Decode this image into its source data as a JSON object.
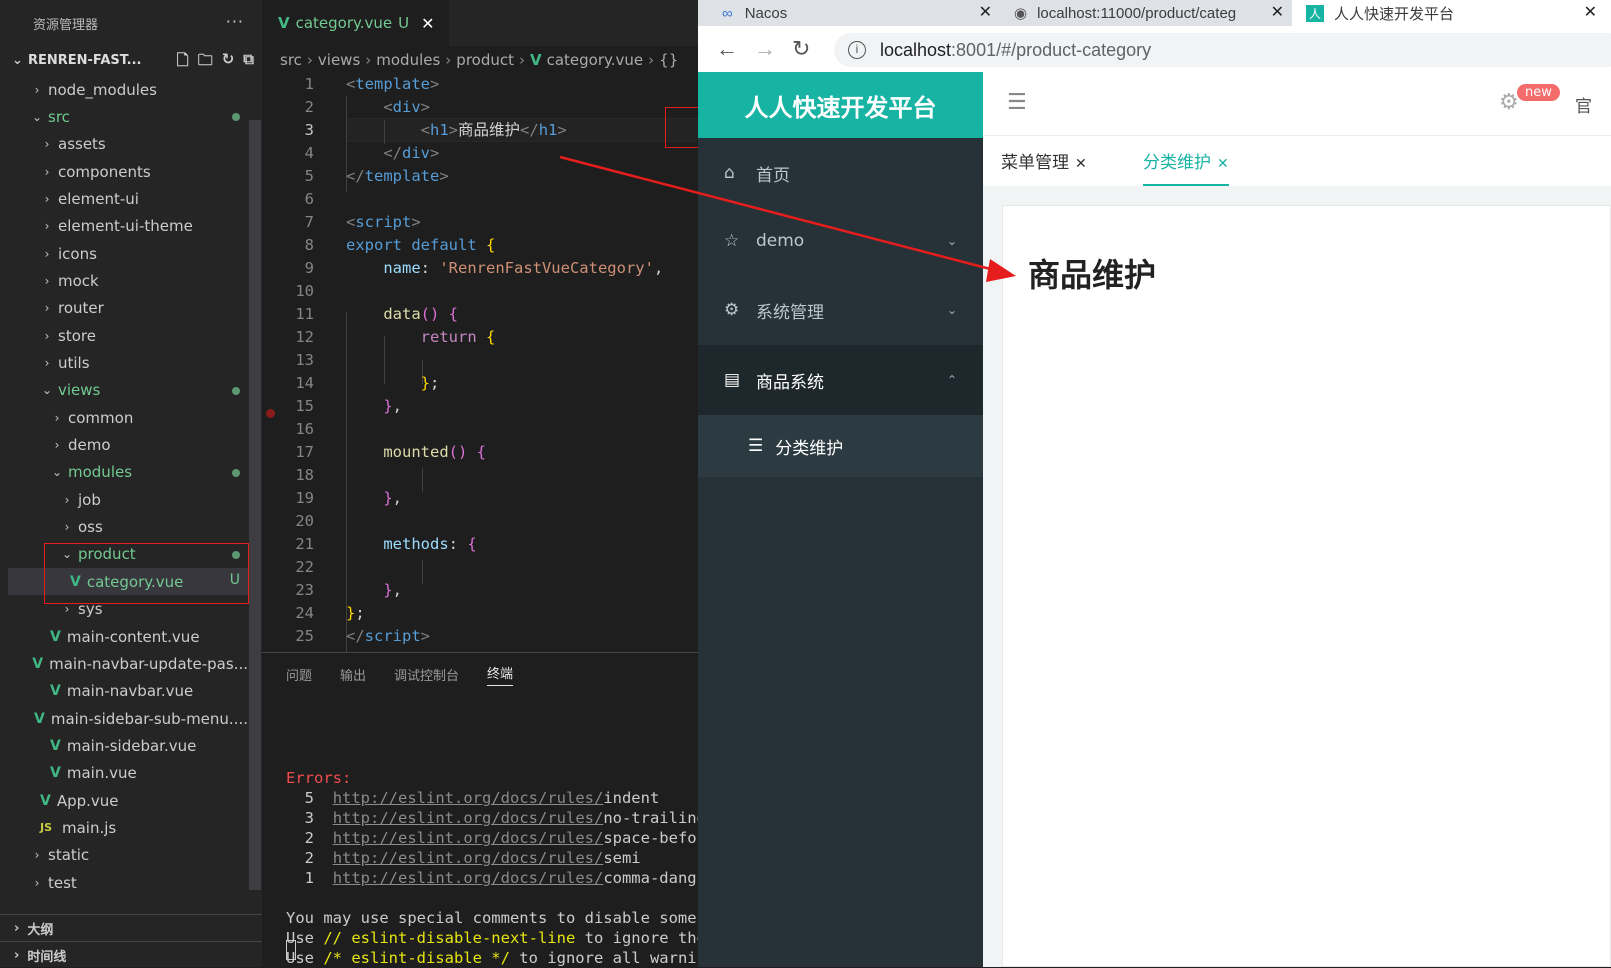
{
  "explorer": {
    "title": "资源管理器",
    "more": "···",
    "project": "RENREN-FAST...",
    "tree": [
      {
        "label": "node_modules",
        "chev": "›",
        "depth": 1
      },
      {
        "label": "src",
        "chev": "⌄",
        "depth": 1,
        "green": true,
        "dot": true
      },
      {
        "label": "assets",
        "chev": "›",
        "depth": 2
      },
      {
        "label": "components",
        "chev": "›",
        "depth": 2
      },
      {
        "label": "element-ui",
        "chev": "›",
        "depth": 2
      },
      {
        "label": "element-ui-theme",
        "chev": "›",
        "depth": 2
      },
      {
        "label": "icons",
        "chev": "›",
        "depth": 2
      },
      {
        "label": "mock",
        "chev": "›",
        "depth": 2
      },
      {
        "label": "router",
        "chev": "›",
        "depth": 2
      },
      {
        "label": "store",
        "chev": "›",
        "depth": 2
      },
      {
        "label": "utils",
        "chev": "›",
        "depth": 2
      },
      {
        "label": "views",
        "chev": "⌄",
        "depth": 2,
        "green": true,
        "dot": true
      },
      {
        "label": "common",
        "chev": "›",
        "depth": 3
      },
      {
        "label": "demo",
        "chev": "›",
        "depth": 3
      },
      {
        "label": "modules",
        "chev": "⌄",
        "depth": 3,
        "green": true,
        "dot": true
      },
      {
        "label": "job",
        "chev": "›",
        "depth": 4
      },
      {
        "label": "oss",
        "chev": "›",
        "depth": 4
      },
      {
        "label": "product",
        "chev": "⌄",
        "depth": 4,
        "green": true,
        "dot": true
      },
      {
        "label": "category.vue",
        "file": "vue",
        "depth": 5,
        "green": true,
        "badge": "U",
        "selected": true
      },
      {
        "label": "sys",
        "chev": "›",
        "depth": 4
      },
      {
        "label": "main-content.vue",
        "file": "vue",
        "depth": 3
      },
      {
        "label": "main-navbar-update-pas...",
        "file": "vue",
        "depth": 3
      },
      {
        "label": "main-navbar.vue",
        "file": "vue",
        "depth": 3
      },
      {
        "label": "main-sidebar-sub-menu....",
        "file": "vue",
        "depth": 3
      },
      {
        "label": "main-sidebar.vue",
        "file": "vue",
        "depth": 3
      },
      {
        "label": "main.vue",
        "file": "vue",
        "depth": 3
      },
      {
        "label": "App.vue",
        "file": "vue",
        "depth": 2
      },
      {
        "label": "main.js",
        "file": "js",
        "depth": 2
      },
      {
        "label": "static",
        "chev": "›",
        "depth": 1
      },
      {
        "label": "test",
        "chev": "›",
        "depth": 1
      }
    ],
    "outline": "大纲",
    "timeline": "时间线"
  },
  "editor": {
    "tab_label": "category.vue",
    "tab_badge": "U",
    "breadcrumb": [
      "src",
      "views",
      "modules",
      "product",
      "category.vue",
      "{}"
    ],
    "panel_tabs": [
      "问题",
      "输出",
      "调试控制台",
      "终端"
    ],
    "terminal": {
      "errors_label": "Errors:",
      "rows": [
        {
          "count": "5",
          "url": "http://eslint.org/docs/rules/",
          "rule": "indent"
        },
        {
          "count": "3",
          "url": "http://eslint.org/docs/rules/",
          "rule": "no-trailing-"
        },
        {
          "count": "2",
          "url": "http://eslint.org/docs/rules/",
          "rule": "space-before"
        },
        {
          "count": "2",
          "url": "http://eslint.org/docs/rules/",
          "rule": "semi"
        },
        {
          "count": "1",
          "url": "http://eslint.org/docs/rules/",
          "rule": "comma-dangle"
        }
      ],
      "hint1": "You may use special comments to disable some w",
      "hint2_pre": "Use ",
      "hint2_code": "// eslint-disable-next-line",
      "hint2_post": " to ignore the",
      "hint3_pre": "Use ",
      "hint3_code": "/* eslint-disable */",
      "hint3_post": " to ignore all warning"
    }
  },
  "browser": {
    "tabs": [
      {
        "title": "Nacos",
        "icon": "∞"
      },
      {
        "title": "localhost:11000/product/categ",
        "icon": "◉"
      },
      {
        "title": "人人快速开发平台",
        "icon": "人"
      }
    ],
    "url_host": "localhost",
    "url_rest": ":8001/#/product-category",
    "app": {
      "logo": "人人快速开发平台",
      "menu": [
        {
          "label": "首页",
          "icon": "⌂"
        },
        {
          "label": "demo",
          "icon": "☆",
          "arrow": "⌄"
        },
        {
          "label": "系统管理",
          "icon": "⚙",
          "arrow": "⌄"
        },
        {
          "label": "商品系统",
          "icon": "▤",
          "arrow": "⌃"
        }
      ],
      "submenu": {
        "label": "分类维护",
        "icon": "☰"
      },
      "header_badge": "new",
      "header_extra": "官",
      "page_tabs": [
        {
          "label": "菜单管理",
          "active": false
        },
        {
          "label": "分类维护",
          "active": true
        }
      ],
      "content_title": "商品维护"
    }
  },
  "colors": {
    "accent": "#17b3a3",
    "sidebar": "#263238",
    "vue_green": "#41b883",
    "annotation_red": "#e51d1d"
  }
}
